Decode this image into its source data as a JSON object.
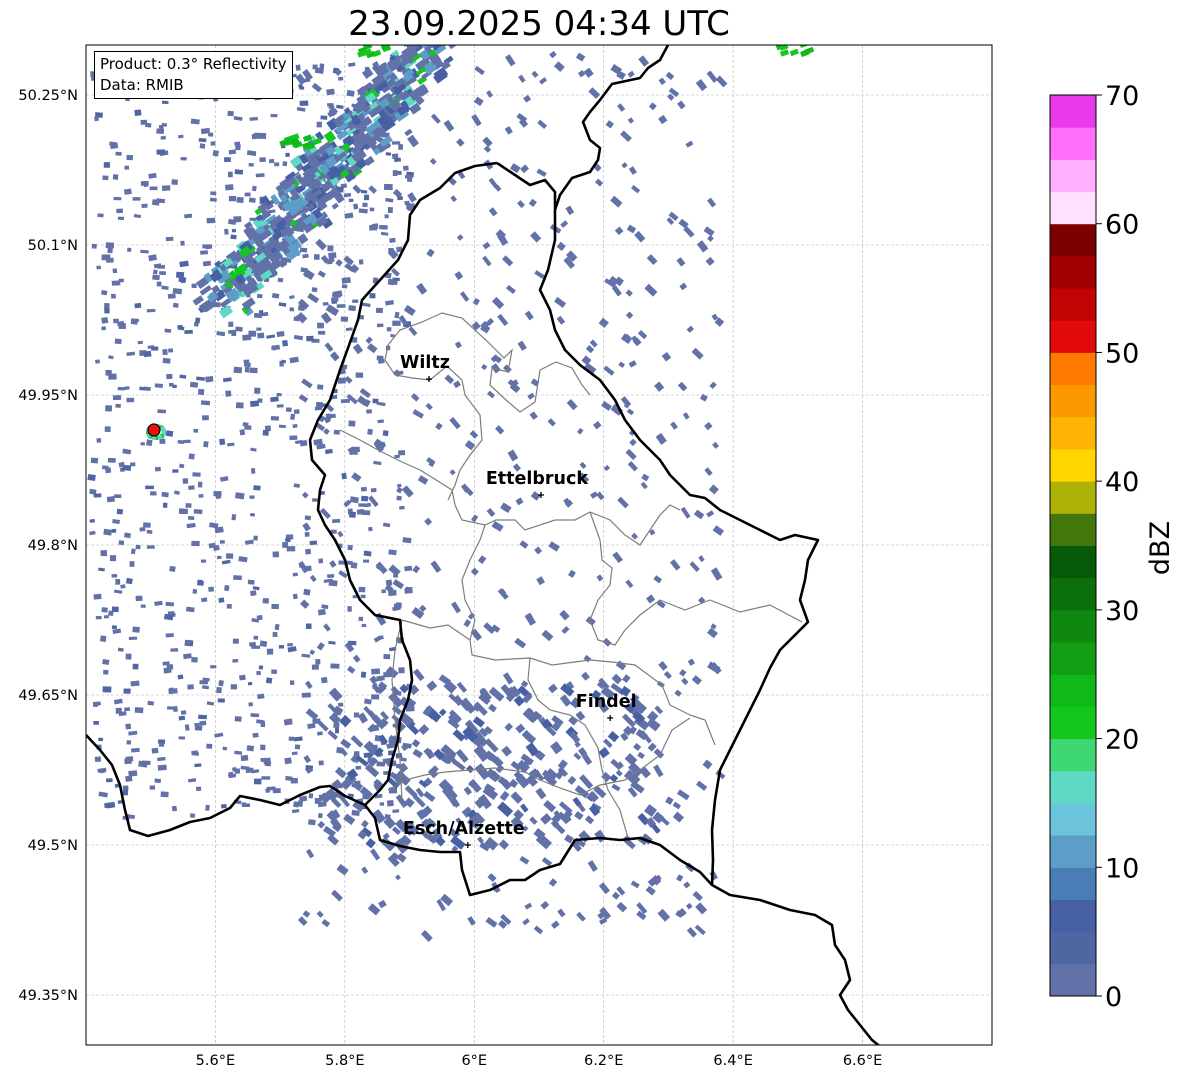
{
  "title": "23.09.2025 04:34 UTC",
  "info": {
    "product": "Product: 0.3° Reflectivity",
    "data": "Data: RMIB"
  },
  "map": {
    "lon_range": [
      5.4,
      6.8
    ],
    "lat_range": [
      49.3,
      50.3
    ],
    "lat_ticks": [
      "50.25°N",
      "50.1°N",
      "49.95°N",
      "49.8°N",
      "49.65°N",
      "49.5°N",
      "49.35°N"
    ],
    "lon_ticks": [
      "5.6°E",
      "5.8°E",
      "6°E",
      "6.2°E",
      "6.4°E",
      "6.6°E"
    ],
    "cities": [
      {
        "name": "Wiltz",
        "lon": 5.93,
        "lat": 49.966
      },
      {
        "name": "Ettelbruck",
        "lon": 6.103,
        "lat": 49.85
      },
      {
        "name": "Findel",
        "lon": 6.21,
        "lat": 49.627
      },
      {
        "name": "Esch/Alzette",
        "lon": 5.99,
        "lat": 49.5
      }
    ],
    "radar_site": {
      "lon": 5.505,
      "lat": 49.915,
      "color": "#e3120b"
    }
  },
  "colorbar": {
    "label": "dBZ",
    "min": 0,
    "max": 70,
    "ticks": [
      "0",
      "10",
      "20",
      "30",
      "40",
      "50",
      "60",
      "70"
    ],
    "colors": [
      "#6272a8",
      "#5066a3",
      "#4660a3",
      "#4a7db5",
      "#5c9ec8",
      "#6bc3dc",
      "#5fd8c4",
      "#3fd774",
      "#13c71f",
      "#10b81a",
      "#129e14",
      "#10870f",
      "#0b6f0b",
      "#075a07",
      "#44770a",
      "#adb207",
      "#ffd600",
      "#fdb404",
      "#fd9900",
      "#ff7a00",
      "#e20a0a",
      "#c10303",
      "#a00000",
      "#7d0000",
      "#ffe0ff",
      "#ffb0ff",
      "#ff6ff9",
      "#e83aea"
    ]
  }
}
